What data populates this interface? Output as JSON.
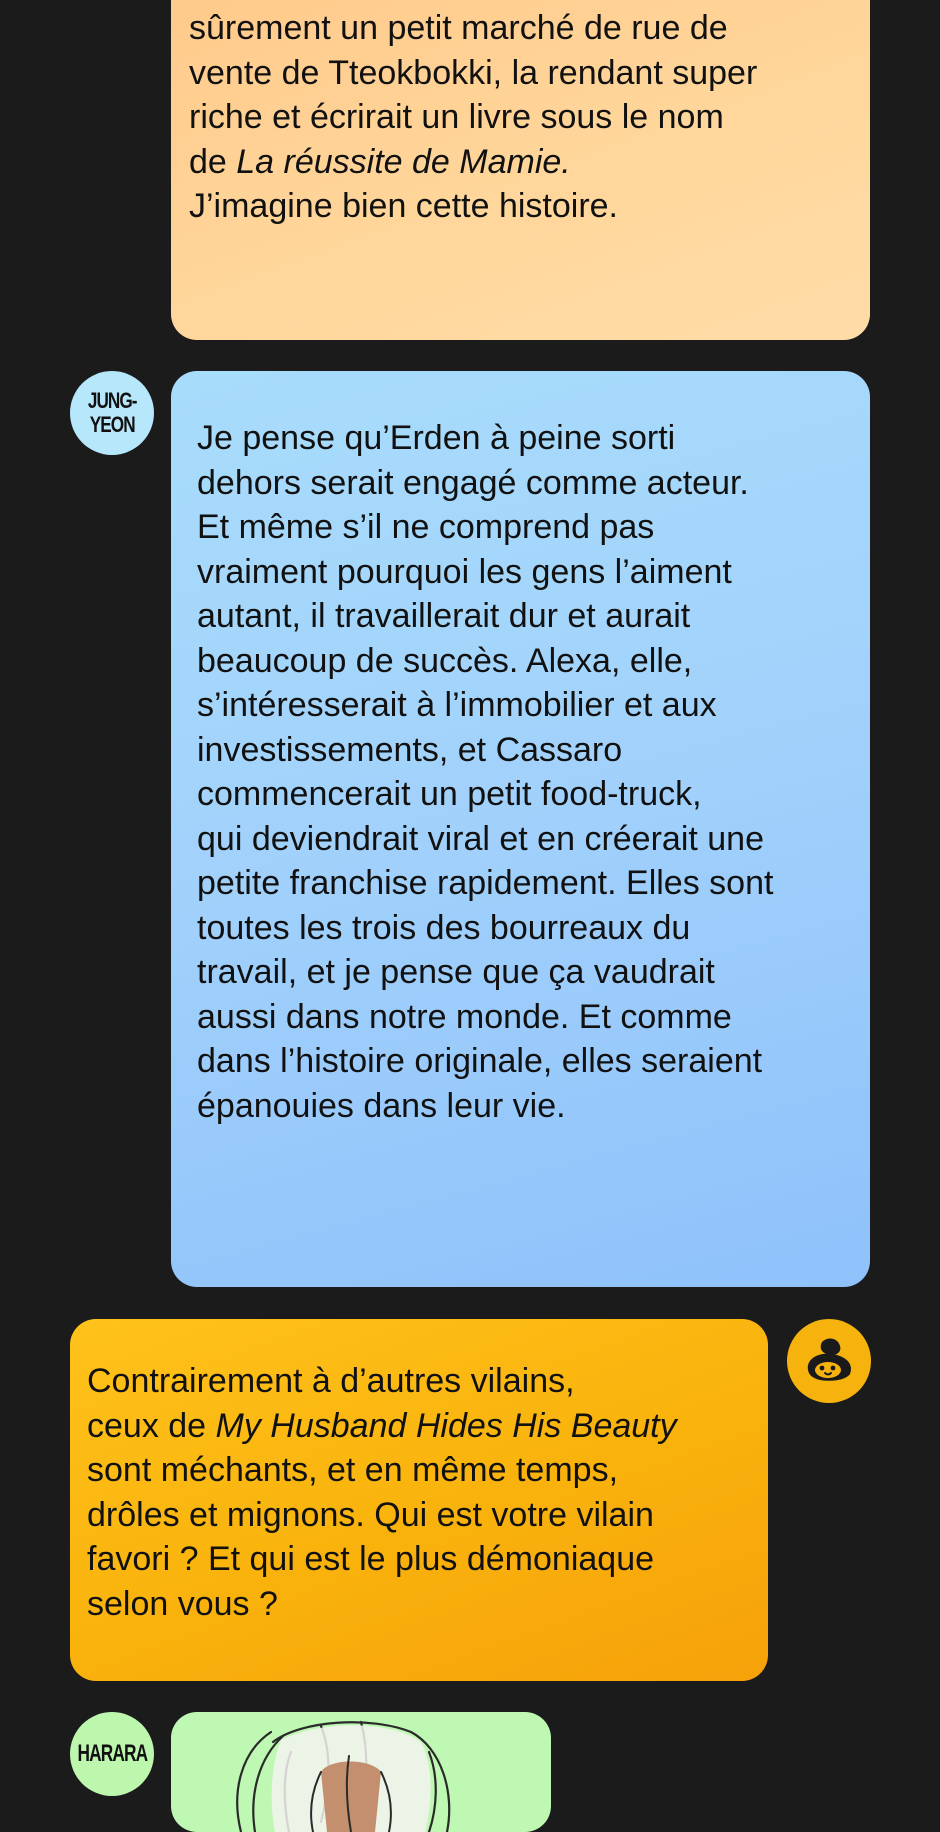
{
  "messages": {
    "top": {
      "text": "sûrement un petit marché de rue de\nvente de Tteokbokki, la rendant super\nriche et écrirait un livre sous le nom\nde ",
      "title_italic": "La réussite de Mamie.",
      "text_after": "\nJ’imagine bien cette histoire."
    },
    "jungyeon": {
      "author": "JUNG-\nYEON",
      "text": "Je pense qu’Erden à peine sorti\ndehors serait engagé comme acteur.\nEt même s’il ne comprend pas\nvraiment pourquoi les gens l’aiment\nautant, il travaillerait dur et aurait\nbeaucoup de succès. Alexa, elle,\ns’intéresserait à l’immobilier et aux\ninvestissements, et Cassaro\ncommencerait un petit food-truck,\nqui deviendrait viral et en créerait une\npetite franchise rapidement. Elles sont\ntoutes les trois des bourreaux du\ntravail, et je pense que ça vaudrait\naussi dans notre monde. Et comme\ndans l’histoire originale, elles seraient\népanouies dans leur vie."
    },
    "host": {
      "text_before": "Contrairement à d’autres vilains,\nceux de ",
      "title_italic": "My Husband Hides His Beauty",
      "text_after": "\nsont méchants, et en même temps,\ndrôles et mignons. Qui est votre vilain\nfavori ? Et qui est le plus démoniaque\nselon vous ?"
    },
    "harara": {
      "author": "HARARA"
    }
  },
  "icons": {
    "host_avatar": "bun-mascot-icon"
  },
  "colors": {
    "background": "#1b1b1b",
    "peach_bubble": "#ffd69b",
    "blue_bubble": "#a2d2fb",
    "orange_bubble": "#f9b20c",
    "green_bubble": "#bff8b3"
  }
}
